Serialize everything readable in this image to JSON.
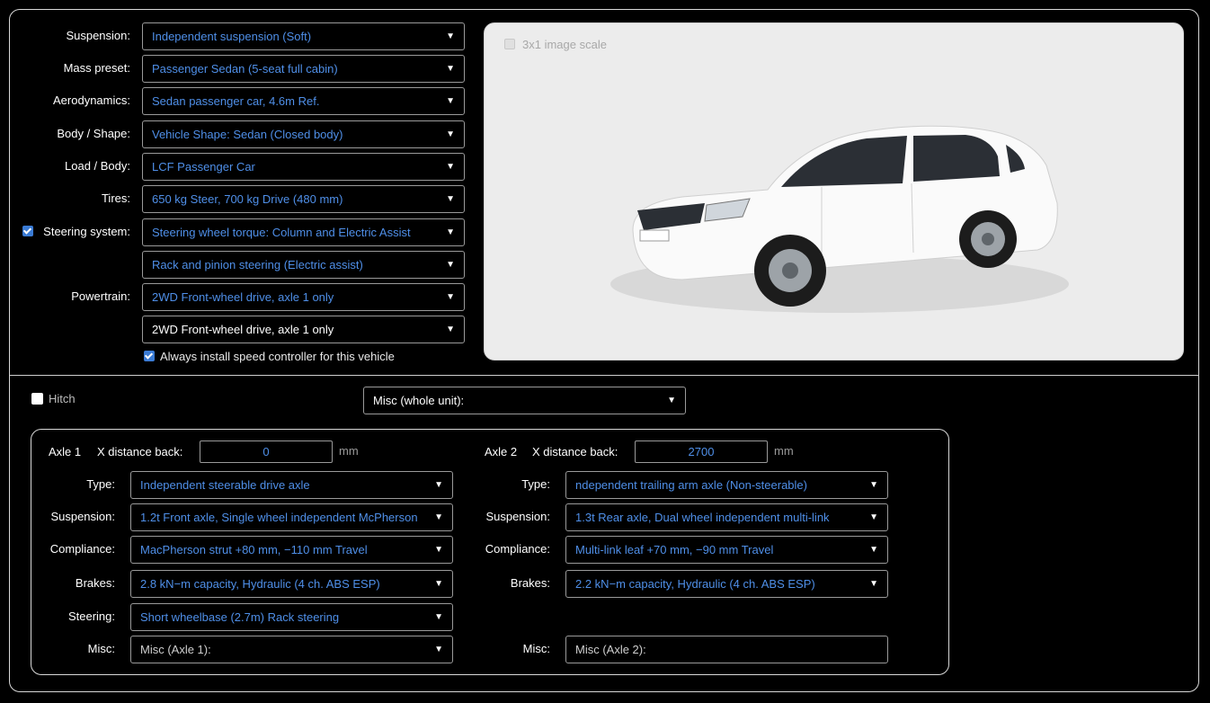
{
  "vehicle": {
    "suspension_label": "Suspension:",
    "suspension_value": "Independent suspension (Soft)",
    "mass_label": "Mass preset:",
    "mass_value": "Passenger Sedan (5-seat full cabin)",
    "aero_label": "Aerodynamics:",
    "aero_value": "Sedan passenger car, 4.6m Ref.",
    "body_label": "Body / Shape:",
    "body_value": "Vehicle Shape: Sedan (Closed body)",
    "load_label": "Load / Body:",
    "load_value": "LCF Passenger Car",
    "tires_label": "Tires:",
    "tires_value": "650 kg Steer, 700 kg Drive (480 mm)",
    "steering_label": "Steering system:",
    "steering_checked": true,
    "steering_value_1": "Steering wheel torque: Column and Electric Assist",
    "steering_value_2": "Rack and pinion steering (Electric assist)",
    "powertrain_label": "Powertrain:",
    "powertrain_value_1": "2WD Front-wheel drive, axle 1 only",
    "powertrain_value_2": "2WD Front-wheel drive, axle 1 only",
    "speed_controller_label": "Always install speed controller for this vehicle",
    "speed_controller_checked": true
  },
  "preview": {
    "scale_label": "3x1 image scale",
    "scale_checked": false
  },
  "unit": {
    "hitch_label": "Hitch",
    "hitch_checked": false,
    "misc_whole_value": "Misc (whole unit):"
  },
  "axle1": {
    "title": "Axle 1",
    "xdist_label": "X distance back:",
    "xdist_value": "0",
    "unit": "mm",
    "type_label": "Type:",
    "type_value": "Independent steerable drive axle",
    "suspension_label": "Suspension:",
    "suspension_value": "1.2t Front axle, Single wheel independent McPherson",
    "compliance_label": "Compliance:",
    "compliance_value": "MacPherson strut +80 mm, −110 mm Travel",
    "brakes_label": "Brakes:",
    "brakes_value": "2.8 kN−m capacity, Hydraulic (4 ch. ABS ESP)",
    "steering_label": "Steering:",
    "steering_value": "Short wheelbase (2.7m) Rack steering",
    "misc_label": "Misc:",
    "misc_value": "Misc (Axle 1):"
  },
  "axle2": {
    "title": "Axle 2",
    "xdist_label": "X distance back:",
    "xdist_value": "2700",
    "unit": "mm",
    "type_label": "Type:",
    "type_value": "ndependent trailing arm axle (Non-steerable)",
    "suspension_label": "Suspension:",
    "suspension_value": "1.3t Rear axle, Dual wheel independent multi-link",
    "compliance_label": "Compliance:",
    "compliance_value": "Multi-link leaf +70 mm, −90 mm Travel",
    "brakes_label": "Brakes:",
    "brakes_value": "2.2 kN−m capacity, Hydraulic (4 ch. ABS ESP)",
    "misc_label": "Misc:",
    "misc_value": "Misc (Axle 2):"
  },
  "icons": {
    "dropdown": "chevron-down-icon",
    "check": "checkmark-icon"
  },
  "colors": {
    "accent": "#3a7bd5",
    "value_text": "#4f8fe8",
    "background": "#000000",
    "preview_bg": "#ececec"
  }
}
